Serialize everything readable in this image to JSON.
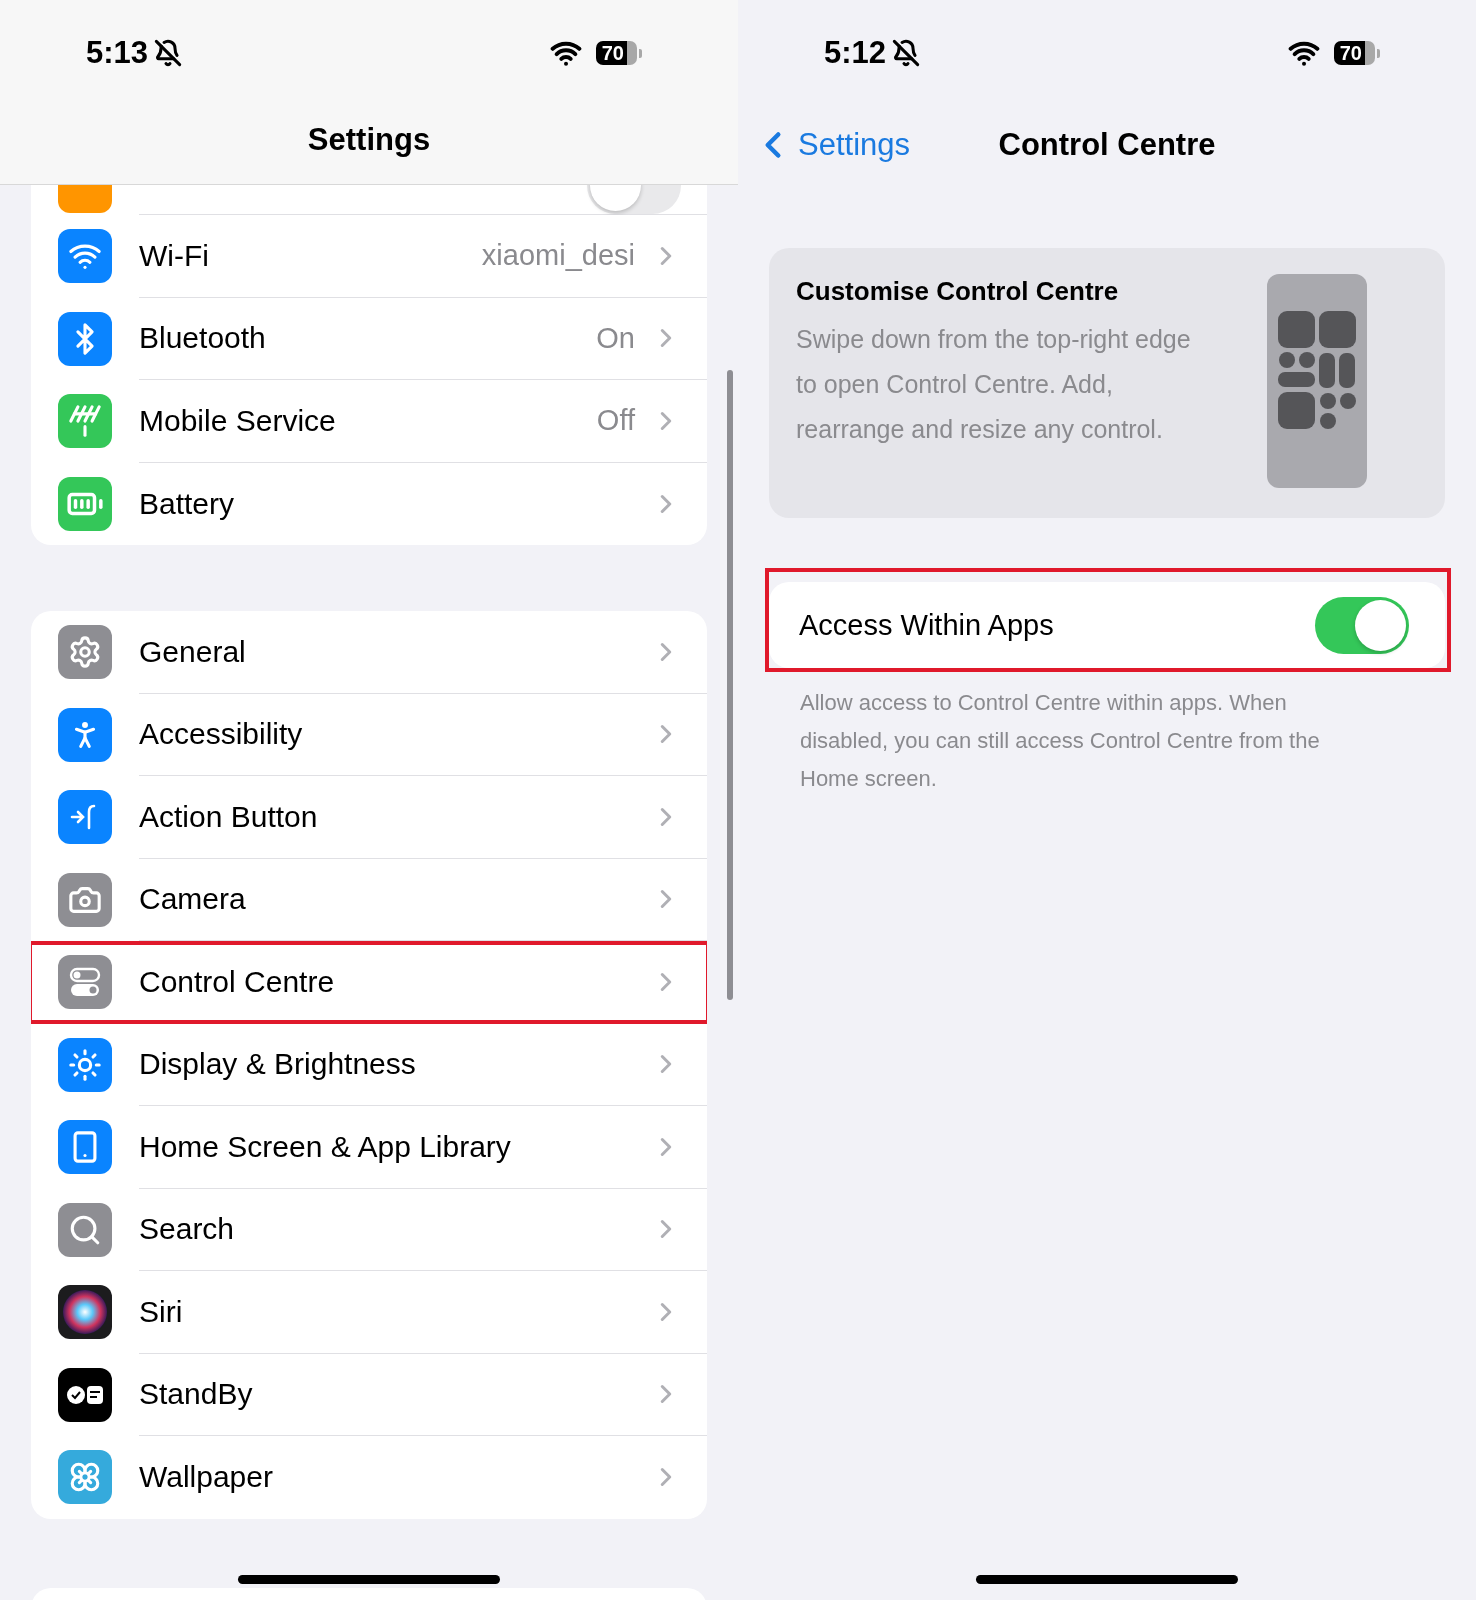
{
  "left": {
    "status_bar": {
      "time": "5:13",
      "battery": "70"
    },
    "title": "Settings",
    "clipped_row": {
      "color": "#ff9500",
      "on": false
    },
    "groups": [
      {
        "rows": [
          {
            "label": "Wi-Fi",
            "value": "xiaomi_desi",
            "color": "#0a84ff",
            "highlighted": false
          },
          {
            "label": "Bluetooth",
            "value": "On",
            "color": "#0a84ff",
            "highlighted": false
          },
          {
            "label": "Mobile Service",
            "value": "Off",
            "color": "#34c759",
            "highlighted": false
          },
          {
            "label": "Battery",
            "color": "#34c759",
            "highlighted": false
          }
        ]
      },
      {
        "rows": [
          {
            "label": "General",
            "color": "#8e8e93",
            "highlighted": false
          },
          {
            "label": "Accessibility",
            "color": "#0a84ff",
            "highlighted": false
          },
          {
            "label": "Action Button",
            "color": "#0a84ff",
            "highlighted": false
          },
          {
            "label": "Camera",
            "color": "#8e8e93",
            "highlighted": false
          },
          {
            "label": "Control Centre",
            "color": "#8e8e93",
            "highlighted": true
          },
          {
            "label": "Display & Brightness",
            "color": "#0a84ff",
            "highlighted": false
          },
          {
            "label": "Home Screen & App Library",
            "color": "#0a84ff",
            "highlighted": false
          },
          {
            "label": "Search",
            "color": "#8e8e93",
            "highlighted": false
          },
          {
            "label": "Siri",
            "color": "#1c1c1e",
            "highlighted": false
          },
          {
            "label": "StandBy",
            "color": "#000000",
            "highlighted": false
          },
          {
            "label": "Wallpaper",
            "color": "#35aadc",
            "highlighted": false
          }
        ]
      }
    ]
  },
  "right": {
    "status_bar": {
      "time": "5:12",
      "battery": "70"
    },
    "back": "Settings",
    "title": "Control Centre",
    "card": {
      "title": "Customise Control Centre",
      "text": "Swipe down from the top-right edge to open Control Centre. Add, rearrange and resize any control."
    },
    "setting": {
      "label": "Access Within Apps",
      "on": true,
      "highlighted": true
    },
    "footer": "Allow access to Control Centre within apps. When disabled, you can still access Control Centre from the Home screen."
  }
}
